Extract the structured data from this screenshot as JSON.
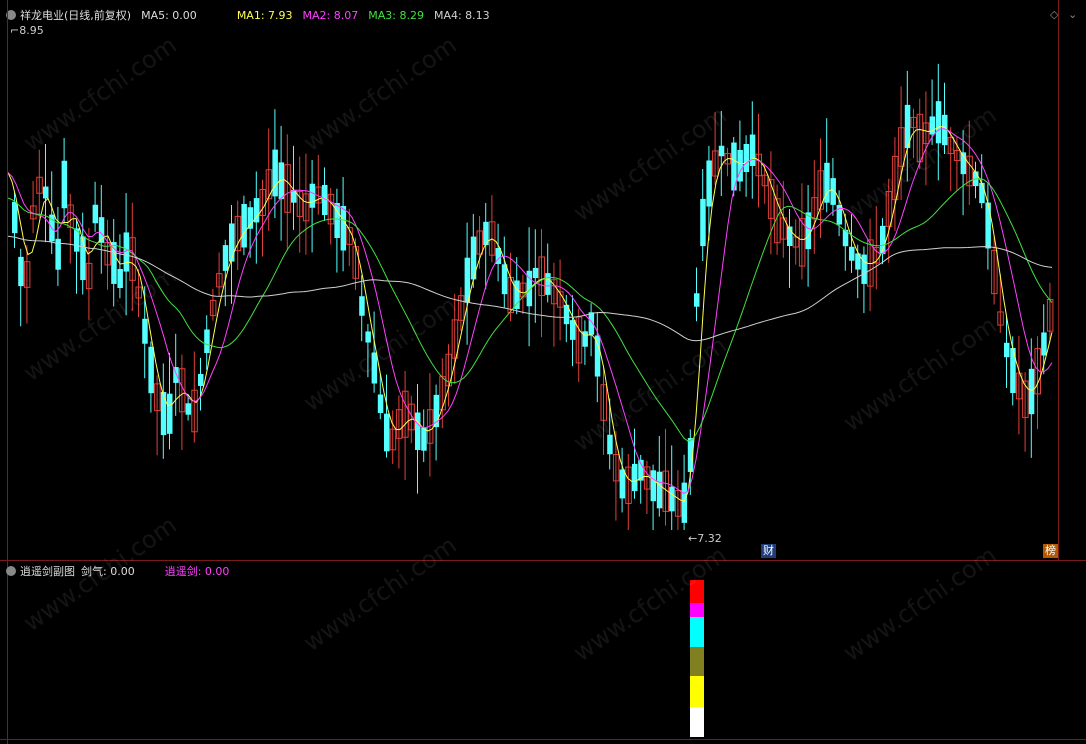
{
  "main": {
    "stock_name": "祥龙电业(日线,前复权)",
    "ma5": "MA5: 0.00",
    "ma1": "MA1: 7.93",
    "ma2": "MA2: 8.07",
    "ma3": "MA3: 8.29",
    "ma4": "MA4: 8.13",
    "high_marker": "8.95",
    "low_marker": "7.32",
    "badge_cai": "财",
    "badge_bang": "榜"
  },
  "sub": {
    "indicator_name": "逍遥剑副图",
    "jianqi": "剑气: 0.00",
    "xiaoyaojian": "逍遥剑: 0.00",
    "stack_colors": [
      "#ffffff",
      "#ffff00",
      "#808020",
      "#00ffff",
      "#ff00ff",
      "#ff0000"
    ]
  },
  "colors": {
    "up": "#e0403a",
    "down": "#54ffff",
    "ma1": "#ffff50",
    "ma2": "#ff40ff",
    "ma3": "#40e040",
    "ma4": "#d0d0d0",
    "frame": "#7a1a1a"
  },
  "watermark": "www.cfchi.com"
}
